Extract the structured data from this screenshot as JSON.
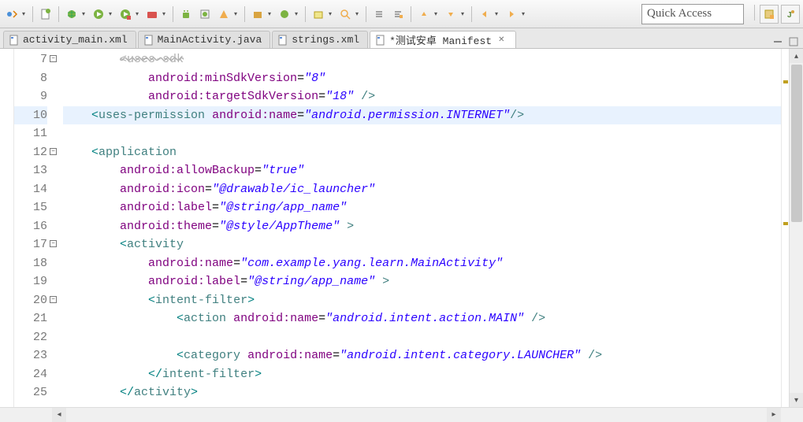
{
  "quick_access": "Quick Access",
  "tabs": [
    {
      "label": "activity_main.xml"
    },
    {
      "label": "MainActivity.java"
    },
    {
      "label": "strings.xml"
    },
    {
      "label": "*测试安卓 Manifest",
      "active": true
    }
  ],
  "code": {
    "lines": [
      {
        "n": "7",
        "fold": "-",
        "i": 2,
        "tokens": [
          {
            "c": "t-gray",
            "t": "<uses-sdk"
          }
        ]
      },
      {
        "n": "8",
        "i": 3,
        "tokens": [
          {
            "c": "t-attr",
            "t": "android:minSdkVersion"
          },
          {
            "c": "t-eq",
            "t": "="
          },
          {
            "c": "t-val",
            "t": "\"8\""
          }
        ]
      },
      {
        "n": "9",
        "i": 3,
        "tokens": [
          {
            "c": "t-attr",
            "t": "android:targetSdkVersion"
          },
          {
            "c": "t-eq",
            "t": "="
          },
          {
            "c": "t-val",
            "t": "\"18\""
          },
          {
            "c": "t-tag",
            "t": " />"
          }
        ]
      },
      {
        "n": "10",
        "hl": true,
        "i": 1,
        "tokens": [
          {
            "c": "t-br",
            "t": "<"
          },
          {
            "c": "t-tag",
            "t": "uses-permission "
          },
          {
            "c": "t-attr",
            "t": "android:name"
          },
          {
            "c": "t-eq",
            "t": "="
          },
          {
            "c": "t-val",
            "t": "\"android.permission.INTERNET\""
          },
          {
            "c": "t-tag",
            "t": "/>"
          }
        ]
      },
      {
        "n": "11",
        "i": 0,
        "tokens": []
      },
      {
        "n": "12",
        "fold": "-",
        "i": 1,
        "tokens": [
          {
            "c": "t-br",
            "t": "<"
          },
          {
            "c": "t-tag",
            "t": "application"
          }
        ]
      },
      {
        "n": "13",
        "i": 2,
        "tokens": [
          {
            "c": "t-attr",
            "t": "android:allowBackup"
          },
          {
            "c": "t-eq",
            "t": "="
          },
          {
            "c": "t-val",
            "t": "\"true\""
          }
        ]
      },
      {
        "n": "14",
        "i": 2,
        "tokens": [
          {
            "c": "t-attr",
            "t": "android:icon"
          },
          {
            "c": "t-eq",
            "t": "="
          },
          {
            "c": "t-val",
            "t": "\"@drawable/ic_launcher\""
          }
        ]
      },
      {
        "n": "15",
        "i": 2,
        "tokens": [
          {
            "c": "t-attr",
            "t": "android:label"
          },
          {
            "c": "t-eq",
            "t": "="
          },
          {
            "c": "t-val",
            "t": "\"@string/app_name\""
          }
        ]
      },
      {
        "n": "16",
        "i": 2,
        "tokens": [
          {
            "c": "t-attr",
            "t": "android:theme"
          },
          {
            "c": "t-eq",
            "t": "="
          },
          {
            "c": "t-val",
            "t": "\"@style/AppTheme\""
          },
          {
            "c": "t-tag",
            "t": " >"
          }
        ]
      },
      {
        "n": "17",
        "fold": "-",
        "i": 2,
        "tokens": [
          {
            "c": "t-br",
            "t": "<"
          },
          {
            "c": "t-tag",
            "t": "activity"
          }
        ]
      },
      {
        "n": "18",
        "i": 3,
        "tokens": [
          {
            "c": "t-attr",
            "t": "android:name"
          },
          {
            "c": "t-eq",
            "t": "="
          },
          {
            "c": "t-val",
            "t": "\"com.example.yang.learn.MainActivity\""
          }
        ]
      },
      {
        "n": "19",
        "i": 3,
        "tokens": [
          {
            "c": "t-attr",
            "t": "android:label"
          },
          {
            "c": "t-eq",
            "t": "="
          },
          {
            "c": "t-val",
            "t": "\"@string/app_name\""
          },
          {
            "c": "t-tag",
            "t": " >"
          }
        ]
      },
      {
        "n": "20",
        "fold": "-",
        "i": 3,
        "tokens": [
          {
            "c": "t-br",
            "t": "<"
          },
          {
            "c": "t-tag",
            "t": "intent-filter"
          },
          {
            "c": "t-br",
            "t": ">"
          }
        ]
      },
      {
        "n": "21",
        "i": 4,
        "tokens": [
          {
            "c": "t-br",
            "t": "<"
          },
          {
            "c": "t-tag",
            "t": "action "
          },
          {
            "c": "t-attr",
            "t": "android:name"
          },
          {
            "c": "t-eq",
            "t": "="
          },
          {
            "c": "t-val",
            "t": "\"android.intent.action.MAIN\""
          },
          {
            "c": "t-tag",
            "t": " />"
          }
        ]
      },
      {
        "n": "22",
        "i": 0,
        "tokens": []
      },
      {
        "n": "23",
        "i": 4,
        "tokens": [
          {
            "c": "t-br",
            "t": "<"
          },
          {
            "c": "t-tag",
            "t": "category "
          },
          {
            "c": "t-attr",
            "t": "android:name"
          },
          {
            "c": "t-eq",
            "t": "="
          },
          {
            "c": "t-val",
            "t": "\"android.intent.category.LAUNCHER\""
          },
          {
            "c": "t-tag",
            "t": " />"
          }
        ]
      },
      {
        "n": "24",
        "i": 3,
        "tokens": [
          {
            "c": "t-br",
            "t": "</"
          },
          {
            "c": "t-tag",
            "t": "intent-filter"
          },
          {
            "c": "t-br",
            "t": ">"
          }
        ]
      },
      {
        "n": "25",
        "i": 2,
        "tokens": [
          {
            "c": "t-br",
            "t": "</"
          },
          {
            "c": "t-tag",
            "t": "activity"
          },
          {
            "c": "t-br",
            "t": ">"
          }
        ]
      }
    ]
  }
}
